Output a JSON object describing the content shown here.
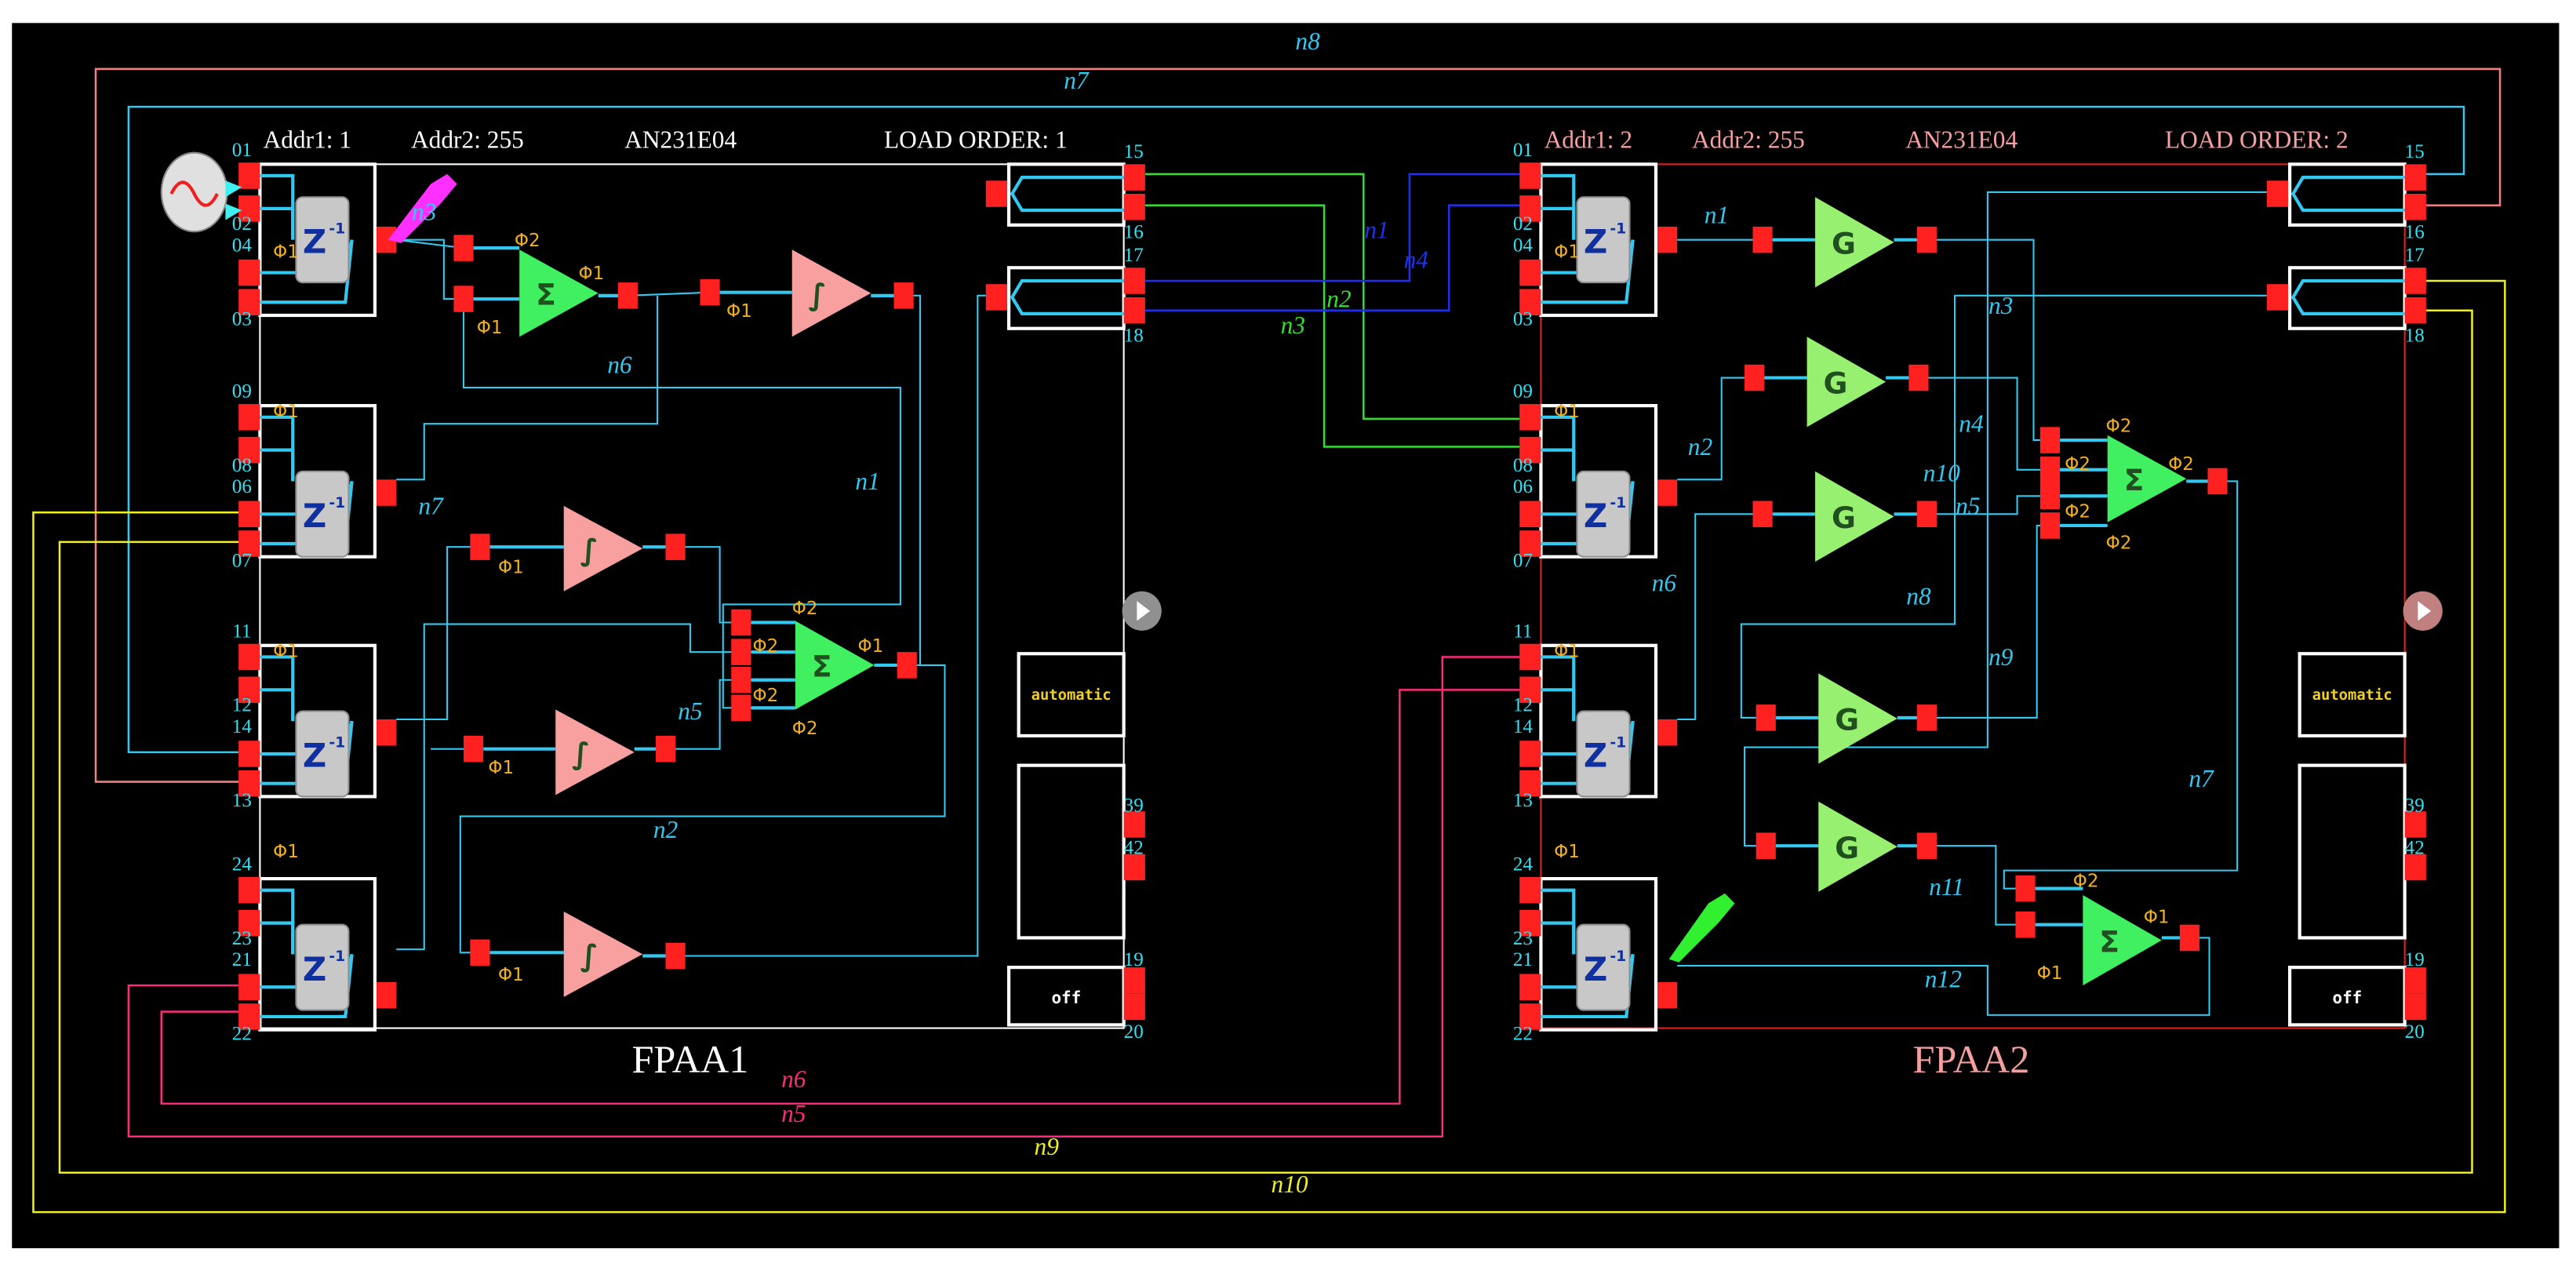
{
  "fpaa1": {
    "name": "FPAA1",
    "addr1": "Addr1: 1",
    "addr2": "Addr2: 255",
    "part": "AN231E04",
    "load_order": "LOAD ORDER: 1",
    "left_pins": [
      "01",
      "02",
      "04",
      "03",
      "09",
      "08",
      "06",
      "07",
      "11",
      "12",
      "14",
      "13",
      "24",
      "23",
      "21",
      "22"
    ],
    "right_pins": [
      "15",
      "16",
      "17",
      "18",
      "39",
      "42",
      "19",
      "20"
    ],
    "mode_button": "automatic",
    "power_button": "off",
    "header_color": "#ffffff",
    "border_color": "#ffffff"
  },
  "fpaa2": {
    "name": "FPAA2",
    "addr1": "Addr1: 2",
    "addr2": "Addr2: 255",
    "part": "AN231E04",
    "load_order": "LOAD ORDER: 2",
    "left_pins": [
      "01",
      "02",
      "04",
      "03",
      "09",
      "08",
      "06",
      "07",
      "11",
      "12",
      "14",
      "13",
      "24",
      "23",
      "21",
      "22"
    ],
    "right_pins": [
      "15",
      "16",
      "17",
      "18",
      "39",
      "42",
      "19",
      "20"
    ],
    "mode_button": "automatic",
    "power_button": "off",
    "header_color": "#f4a0a0",
    "border_color": "#e02020"
  },
  "glyphs": {
    "delay": "Z",
    "delay_exp": "-1",
    "sum": "Σ",
    "integrator": "∫",
    "gain": "G",
    "plus": "+",
    "minus": "-"
  },
  "phases": {
    "p1": "Φ1",
    "p2": "Φ2"
  },
  "nets": {
    "outer": [
      "n8",
      "n7",
      "n6",
      "n5",
      "n9",
      "n10"
    ],
    "bridge": [
      "n1",
      "n4",
      "n2",
      "n3"
    ],
    "fpaa1": [
      "n3",
      "n6",
      "n7",
      "n1",
      "n5",
      "n2"
    ],
    "fpaa2": [
      "n1",
      "n3",
      "n2",
      "n4",
      "n10",
      "n5",
      "n6",
      "n8",
      "n9",
      "n7",
      "n11",
      "n12"
    ]
  },
  "colors": {
    "wire": "#33c8f0",
    "pad": "#ff2020",
    "sum": "#40f060",
    "integrator": "#f8a0a0",
    "gain": "#98f070",
    "outer_n8": "#f08080",
    "pink_net": "#ff2a7a",
    "yellow_net": "#f0f020",
    "green_net": "#30e030",
    "blue_net": "#2030f0"
  }
}
